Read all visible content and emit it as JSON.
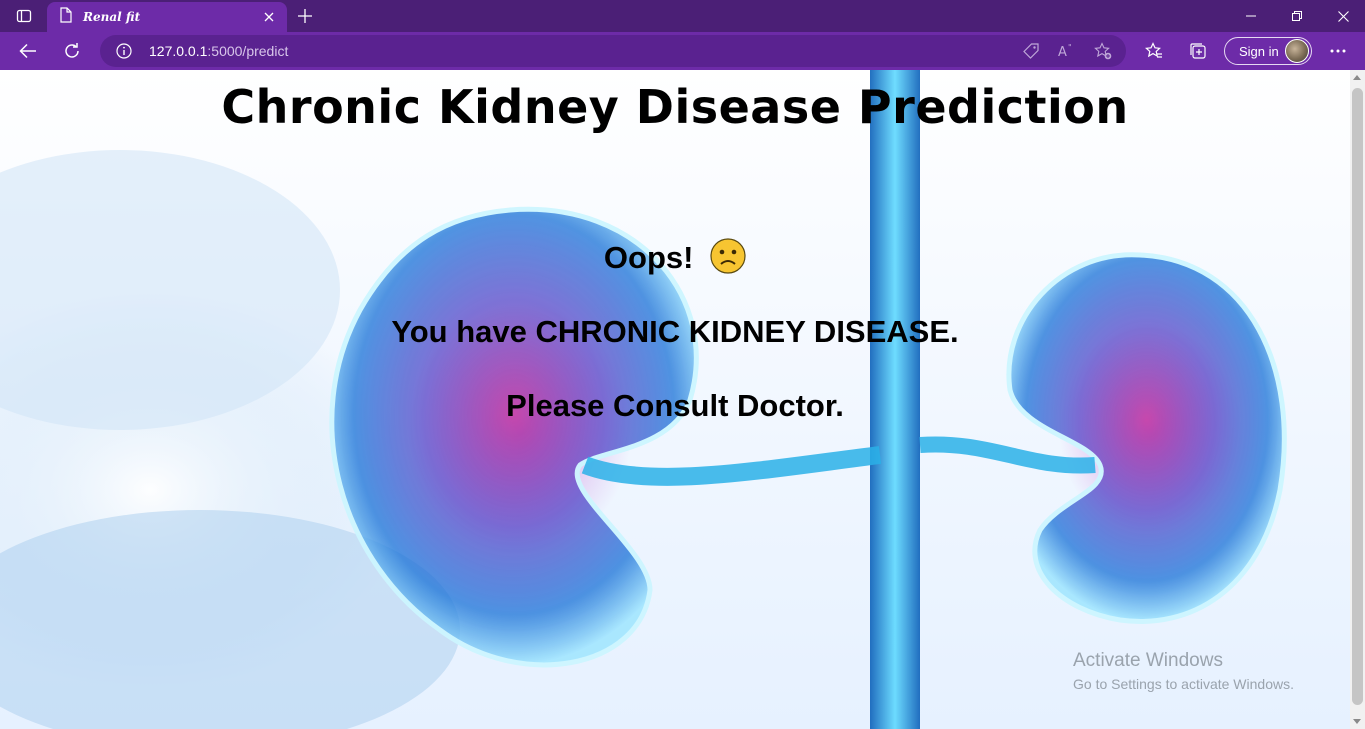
{
  "browser": {
    "tab_title": "Renal fit",
    "url_host": "127.0.0.1",
    "url_path": ":5000/predict",
    "signin_label": "Sign in",
    "colors": {
      "titlebar": "#4b1f76",
      "toolbar": "#6d2ba8",
      "omnibox": "#5a2290"
    }
  },
  "page": {
    "title": "Chronic Kidney Disease Prediction",
    "oops": "Oops!",
    "result": "You have CHRONIC KIDNEY DISEASE.",
    "advice": "Please Consult Doctor."
  },
  "watermark": {
    "line1": "Activate Windows",
    "line2": "Go to Settings to activate Windows."
  },
  "icons": [
    "tab-actions-icon",
    "page-icon",
    "close-icon",
    "plus-icon",
    "minimize-icon",
    "restore-icon",
    "back-arrow-icon",
    "refresh-icon",
    "info-icon",
    "tag-icon",
    "read-aloud-icon",
    "add-favorite-icon",
    "favorites-icon",
    "collections-icon",
    "more-icon",
    "sad-face-icon"
  ]
}
